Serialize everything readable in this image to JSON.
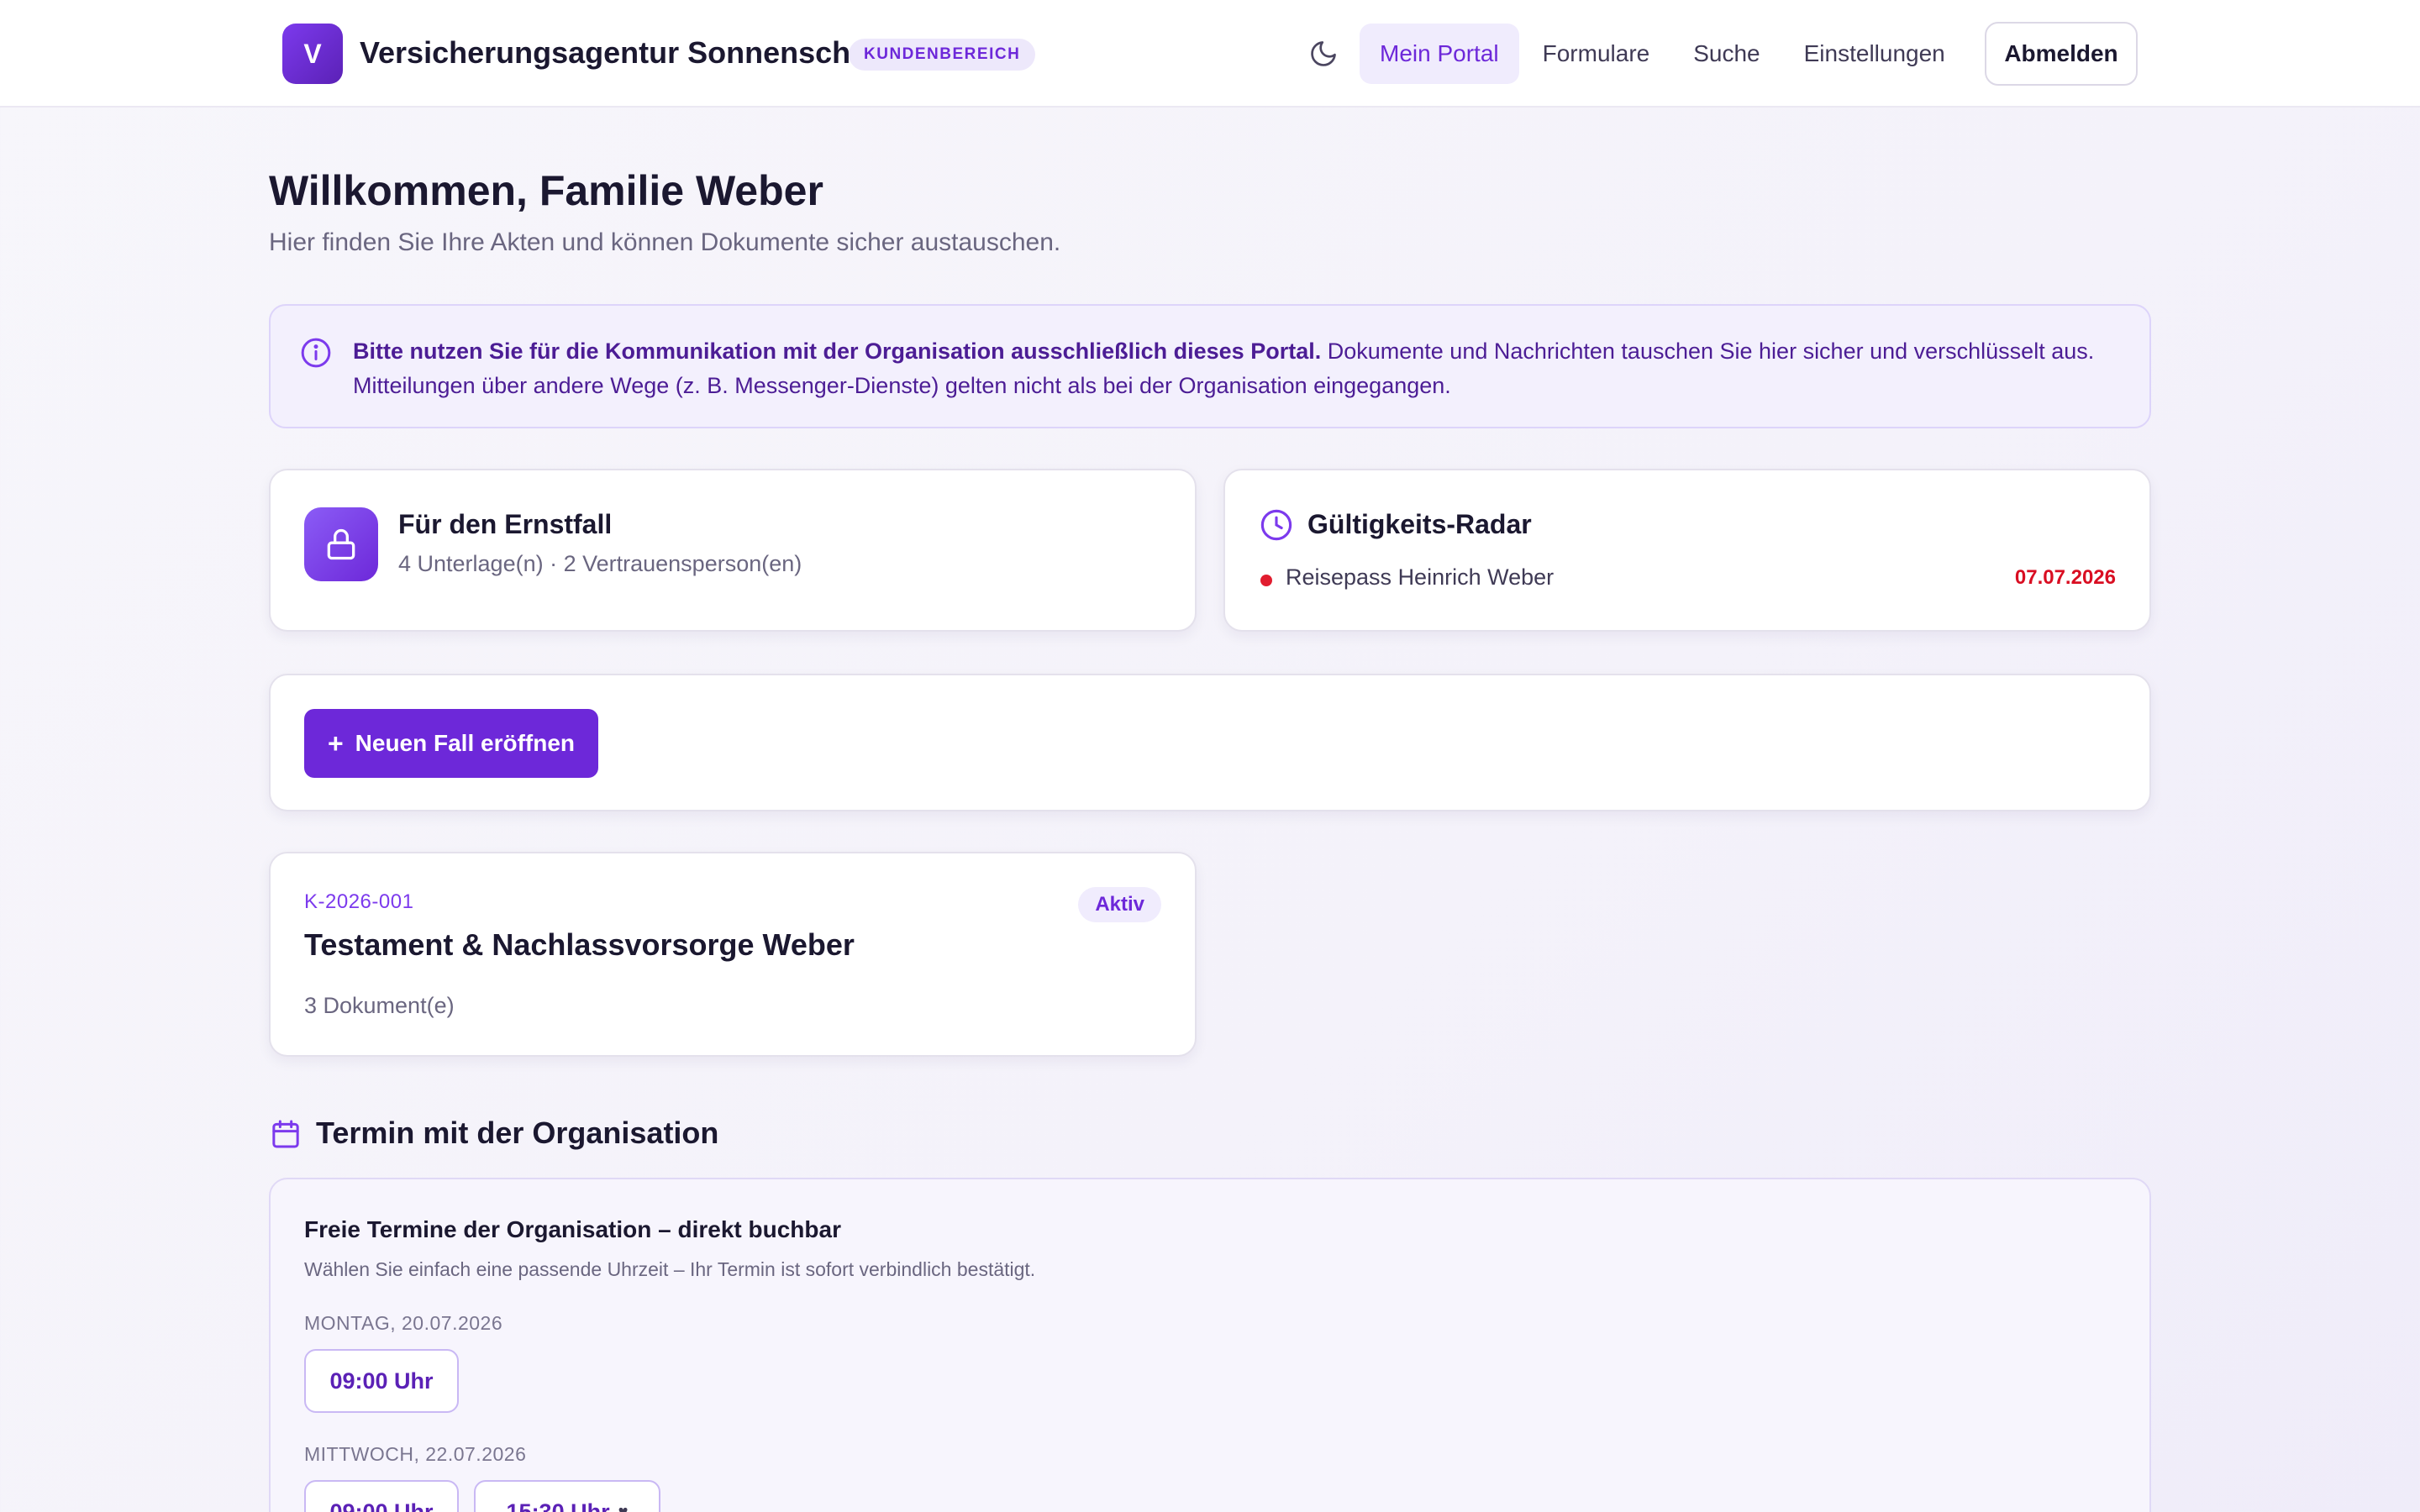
{
  "header": {
    "logo_letter": "V",
    "brand_name": "Versicherungsagentur Sonnenschein",
    "badge": "KUNDENBEREICH",
    "theme_toggle_icon": "moon-icon",
    "nav": [
      {
        "label": "Mein Portal",
        "active": true
      },
      {
        "label": "Formulare",
        "active": false
      },
      {
        "label": "Suche",
        "active": false
      },
      {
        "label": "Einstellungen",
        "active": false
      }
    ],
    "logout_label": "Abmelden"
  },
  "welcome": {
    "title": "Willkommen, Familie Weber",
    "subtitle": "Hier finden Sie Ihre Akten und können Dokumente sicher austauschen."
  },
  "notice": {
    "icon": "info-icon",
    "bold_text": "Bitte nutzen Sie für die Kommunikation mit der Organisation ausschließlich dieses Portal.",
    "text": " Dokumente und Nachrichten tauschen Sie hier sicher und verschlüsselt aus. Mitteilungen über andere Wege (z. B. Messenger-Dienste) gelten nicht als bei der Organisation eingegangen."
  },
  "emergency": {
    "icon": "lock-icon",
    "title": "Für den Ernstfall",
    "meta": "4 Unterlage(n) · 2 Vertrauensperson(en)"
  },
  "radar": {
    "icon": "clock-icon",
    "title": "Gültigkeits-Radar",
    "items": [
      {
        "label": "Reisepass Heinrich Weber",
        "date": "07.07.2026",
        "status_color": "#e11d2f"
      }
    ]
  },
  "actions": {
    "new_case_icon": "+",
    "new_case_label": "Neuen Fall eröffnen"
  },
  "cases": [
    {
      "id": "K-2026-001",
      "status": "Aktiv",
      "title": "Testament & Nachlassvorsorge Weber",
      "documents": "3 Dokument(e)"
    }
  ],
  "appointments": {
    "section_icon": "calendar-icon",
    "section_title": "Termin mit der Organisation",
    "heading": "Freie Termine der Organisation – direkt buchbar",
    "hint": "Wählen Sie einfach eine passende Uhrzeit – Ihr Termin ist sofort verbindlich bestätigt.",
    "days": [
      {
        "label": "MONTAG, 20.07.2026",
        "slots": [
          "09:00 Uhr"
        ]
      },
      {
        "label": "MITTWOCH, 22.07.2026",
        "slots": [
          "09:00 Uhr",
          "15:30 Uhr"
        ]
      }
    ],
    "favorite_icon": "heart-icon",
    "favorite_glyph": "♥"
  },
  "colors": {
    "accent": "#6d28d9",
    "accent_light": "#f0ecfd",
    "danger": "#e11d2f"
  }
}
